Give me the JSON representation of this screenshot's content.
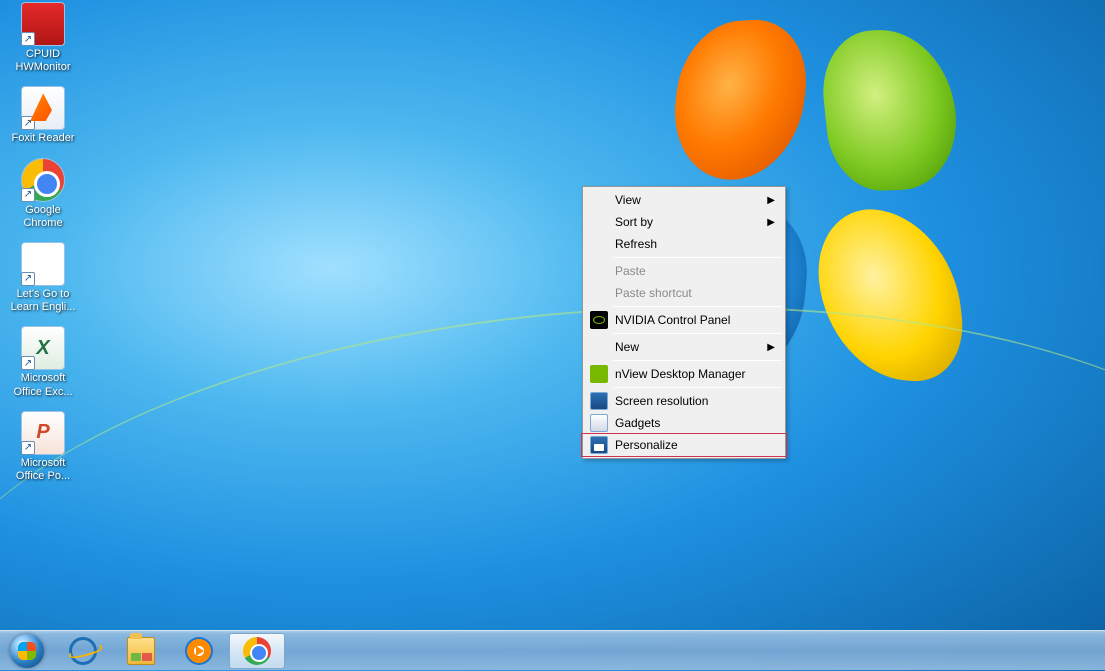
{
  "desktop": {
    "icons": [
      {
        "id": "cpuid-hwmonitor",
        "label": "CPUID HWMonitor",
        "shortcut": true,
        "icon": "hwmonitor"
      },
      {
        "id": "foxit-reader",
        "label": "Foxit Reader",
        "shortcut": true,
        "icon": "foxit"
      },
      {
        "id": "google-chrome",
        "label": "Google Chrome",
        "shortcut": true,
        "icon": "chrome"
      },
      {
        "id": "lets-go-english",
        "label": "Let's Go to Learn Engli...",
        "shortcut": true,
        "icon": "letsgo"
      },
      {
        "id": "ms-excel",
        "label": "Microsoft Office Exc...",
        "shortcut": true,
        "icon": "excel"
      },
      {
        "id": "ms-powerpoint",
        "label": "Microsoft Office Po...",
        "shortcut": true,
        "icon": "ppt"
      }
    ]
  },
  "context_menu": {
    "items": [
      {
        "label": "View",
        "submenu": true,
        "enabled": true,
        "icon": null
      },
      {
        "label": "Sort by",
        "submenu": true,
        "enabled": true,
        "icon": null
      },
      {
        "label": "Refresh",
        "submenu": false,
        "enabled": true,
        "icon": null
      },
      {
        "sep": true
      },
      {
        "label": "Paste",
        "submenu": false,
        "enabled": false,
        "icon": null
      },
      {
        "label": "Paste shortcut",
        "submenu": false,
        "enabled": false,
        "icon": null
      },
      {
        "sep": true
      },
      {
        "label": "NVIDIA Control Panel",
        "submenu": false,
        "enabled": true,
        "icon": "nvidia-eye"
      },
      {
        "sep": true
      },
      {
        "label": "New",
        "submenu": true,
        "enabled": true,
        "icon": null
      },
      {
        "sep": true
      },
      {
        "label": "nView Desktop Manager",
        "submenu": false,
        "enabled": true,
        "icon": "nvidia-logo"
      },
      {
        "sep": true
      },
      {
        "label": "Screen resolution",
        "submenu": false,
        "enabled": true,
        "icon": "screenres"
      },
      {
        "label": "Gadgets",
        "submenu": false,
        "enabled": true,
        "icon": "gadgets"
      },
      {
        "label": "Personalize",
        "submenu": false,
        "enabled": true,
        "icon": "personalize",
        "highlighted": true
      }
    ]
  },
  "taskbar": {
    "items": [
      {
        "id": "ie",
        "name": "internet-explorer",
        "running": false
      },
      {
        "id": "explorer",
        "name": "file-explorer",
        "running": false
      },
      {
        "id": "wmp",
        "name": "media-player",
        "running": false
      },
      {
        "id": "chrome",
        "name": "google-chrome",
        "running": true
      }
    ]
  }
}
